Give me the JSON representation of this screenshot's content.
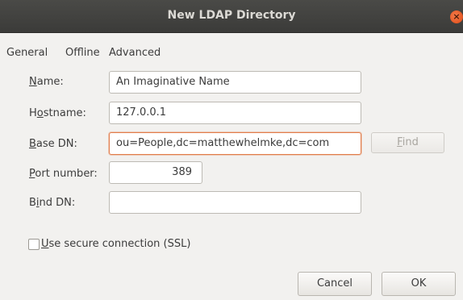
{
  "window": {
    "title": "New LDAP Directory",
    "close_glyph": "×"
  },
  "tabs": [
    {
      "label": "General"
    },
    {
      "label": "Offline"
    },
    {
      "label": "Advanced"
    }
  ],
  "form": {
    "name": {
      "label_key": "N",
      "label_rest": "ame:",
      "value": "An Imaginative Name"
    },
    "hostname": {
      "label_pre": "H",
      "label_key": "o",
      "label_rest": "stname:",
      "value": "127.0.0.1"
    },
    "base_dn": {
      "label_key": "B",
      "label_rest": "ase DN:",
      "value": "ou=People,dc=matthewhelmke,dc=com"
    },
    "port": {
      "label_key": "P",
      "label_rest": "ort number:",
      "value": "389"
    },
    "bind_dn": {
      "label_pre": "B",
      "label_key": "i",
      "label_rest": "nd DN:",
      "value": ""
    },
    "find_button": {
      "label_key": "F",
      "label_rest": "ind"
    },
    "ssl": {
      "label_key": "U",
      "label_rest": "se secure connection (SSL)",
      "checked": false
    }
  },
  "buttons": {
    "cancel": "Cancel",
    "ok": "OK"
  },
  "colors": {
    "titlebar": "#3b3b39",
    "focus_border": "#e27d4c",
    "close_button": "#df4a16"
  }
}
